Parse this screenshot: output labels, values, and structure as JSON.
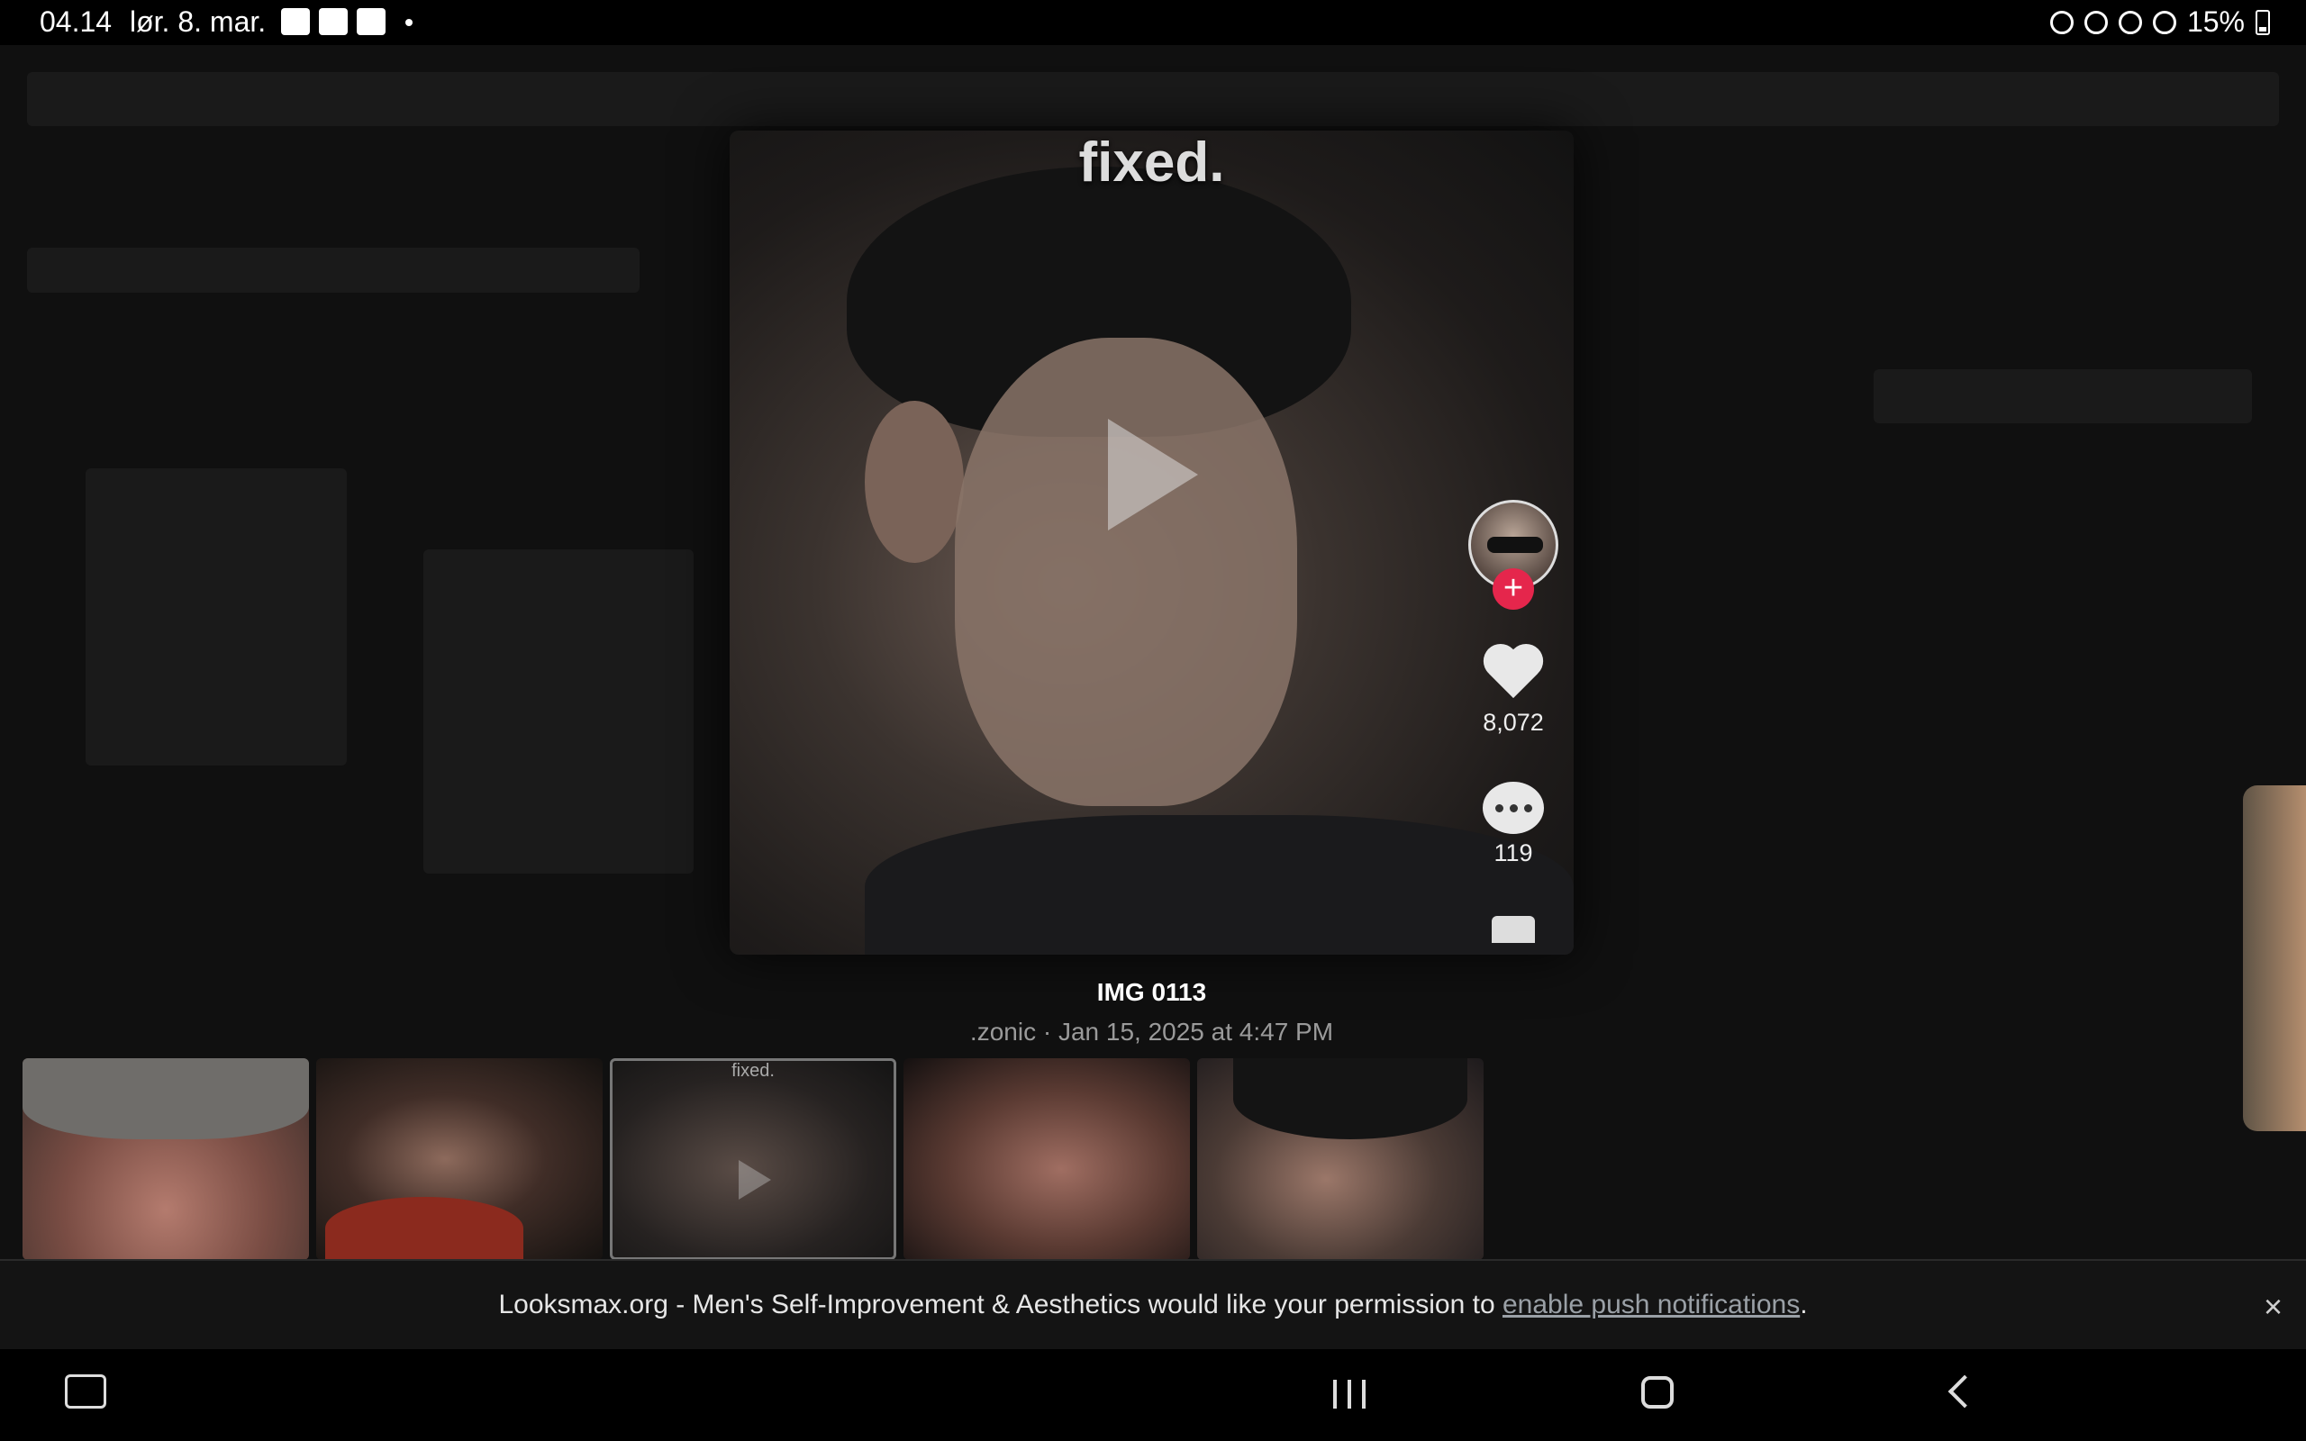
{
  "status_bar": {
    "time": "04.14",
    "date": "lør. 8. mar.",
    "battery": "15%",
    "left_icons": [
      "accessibility-icon",
      "calendar-icon",
      "image-icon"
    ],
    "right_icons": [
      "alarm-icon",
      "bluetooth-icon",
      "mute-icon",
      "wifi-icon",
      "battery-icon"
    ]
  },
  "viewer": {
    "caption": "fixed.",
    "likes": "8,072",
    "comments": "119",
    "follow_symbol": "+",
    "title": "IMG 0113",
    "meta": ".zonic · Jan 15, 2025 at 4:47 PM"
  },
  "thumbnails": {
    "active_caption": "fixed."
  },
  "banner": {
    "text": "Looksmax.org - Men's Self-Improvement & Aesthetics would like your permission to ",
    "link": "enable push notifications",
    "suffix": ".",
    "close": "×"
  },
  "colors": {
    "follow_button": "#e5264c",
    "banner_bg": "#141414"
  }
}
